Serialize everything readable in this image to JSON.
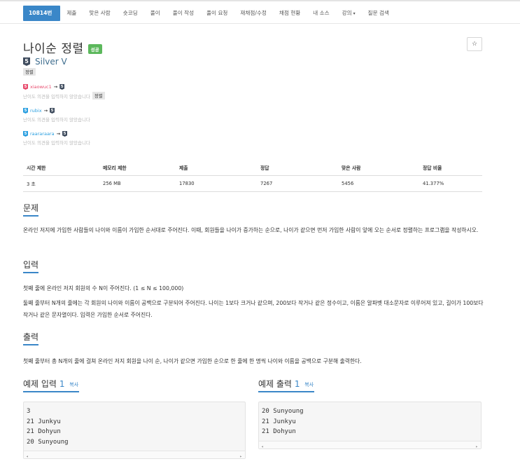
{
  "nav": {
    "items": [
      {
        "label": "10814번",
        "active": true
      },
      {
        "label": "제출"
      },
      {
        "label": "맞은 사람"
      },
      {
        "label": "숏코딩"
      },
      {
        "label": "풀이"
      },
      {
        "label": "풀이 작성"
      },
      {
        "label": "풀이 요청"
      },
      {
        "label": "재채점/수정"
      },
      {
        "label": "채점 현황"
      },
      {
        "label": "내 소스"
      },
      {
        "label": "강의",
        "caret": "▾"
      },
      {
        "label": "질문 검색"
      }
    ]
  },
  "problem": {
    "title": "나이순 정렬",
    "status_badge": "성공",
    "star_icon": "☆",
    "tier_number": "5",
    "tier_label": "Silver V",
    "algorithm_tag": "정렬"
  },
  "votes": [
    {
      "user": "xiaowuc1",
      "from_tier": "5",
      "to_tier": "5",
      "note": "난이도 의견을 입력하지 않았습니다",
      "tag": "정렬"
    },
    {
      "user": "rubix",
      "from_tier": "5",
      "to_tier": "5",
      "note": "난이도 의견을 입력하지 않았습니다",
      "tag": ""
    },
    {
      "user": "raararaara",
      "from_tier": "5",
      "to_tier": "5",
      "note": "난이도 의견을 입력하지 않았습니다",
      "tag": ""
    }
  ],
  "stats": {
    "headers": [
      "시간 제한",
      "메모리 제한",
      "제출",
      "정답",
      "맞은 사람",
      "정답 비율"
    ],
    "values": [
      "3 초",
      "256 MB",
      "17830",
      "7267",
      "5456",
      "41.377%"
    ]
  },
  "sections": {
    "problem_title": "문제",
    "problem_text": "온라인 저지에 가입한 사람들의 나이와 이름이 가입한 순서대로 주어진다. 이때, 회원들을 나이가 증가하는 순으로, 나이가 같으면 먼저 가입한 사람이 앞에 오는 순서로 정렬하는 프로그램을 작성하시오.",
    "input_title": "입력",
    "input_text_1": "첫째 줄에 온라인 저지 회원의 수 N이 주어진다. (1 ≤ N ≤ 100,000)",
    "input_text_2": "둘째 줄부터 N개의 줄에는 각 회원의 나이와 이름이 공백으로 구분되어 주어진다. 나이는 1보다 크거나 같으며, 200보다 작거나 같은 정수이고, 이름은 알파벳 대소문자로 이루어져 있고, 길이가 100보다 작거나 같은 문자열이다. 입력은 가입한 순서로 주어진다.",
    "output_title": "출력",
    "output_text": "첫째 줄부터 총 N개의 줄에 걸쳐 온라인 저지 회원을 나이 순, 나이가 같으면 가입한 순으로 한 줄에 한 명씩 나이와 이름을 공백으로 구분해 출력한다."
  },
  "samples": {
    "input_title": "예제 입력",
    "input_num": "1",
    "output_title": "예제 출력",
    "output_num": "1",
    "copy_label": "복사",
    "input_lines": [
      "3",
      "21 Junkyu",
      "21 Dohyun",
      "20 Sunyoung"
    ],
    "output_lines": [
      "20 Sunyoung",
      "21 Junkyu",
      "21 Dohyun"
    ],
    "scroll_left": "◂",
    "scroll_right": "▸"
  }
}
